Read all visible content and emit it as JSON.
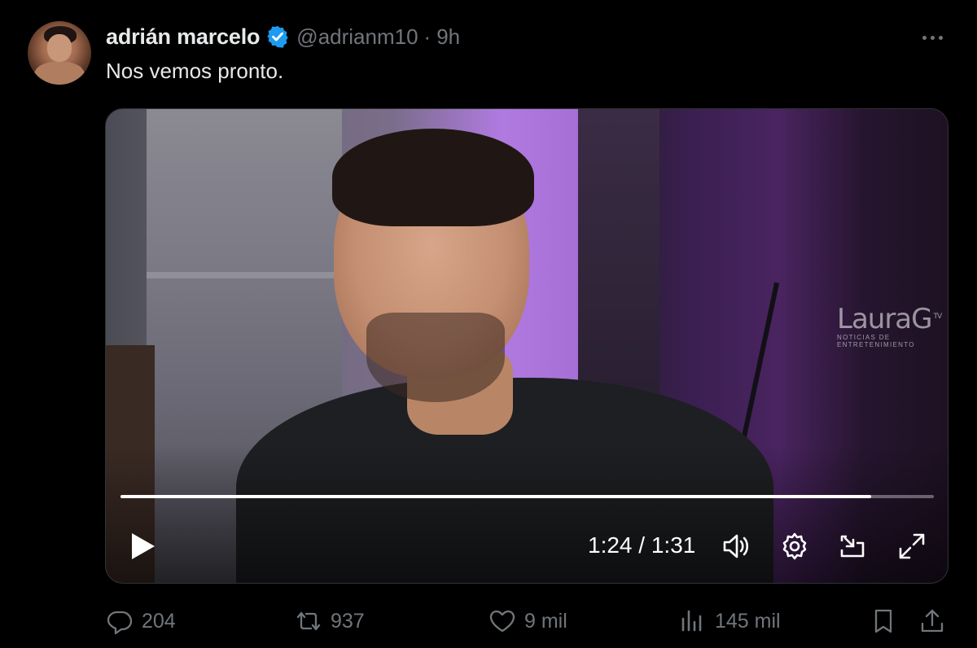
{
  "tweet": {
    "author_name": "adrián marcelo",
    "handle": "@adrianm10",
    "separator": "·",
    "time": "9h",
    "text": "Nos vemos pronto.",
    "verified_color": "#1d9bf0"
  },
  "video": {
    "watermark_logo": "LauraG",
    "watermark_tv": "TV",
    "watermark_sub": "NOTICIAS DE ENTRETENIMIENTO",
    "progress_fraction": 0.923,
    "time_current": "1:24",
    "time_separator": "/",
    "time_total": "1:31",
    "icons": [
      "play-icon",
      "volume-icon",
      "settings-icon",
      "picture-in-picture-icon",
      "fullscreen-icon"
    ]
  },
  "actions": {
    "replies": "204",
    "reposts": "937",
    "likes": "9 mil",
    "views": "145 mil"
  }
}
